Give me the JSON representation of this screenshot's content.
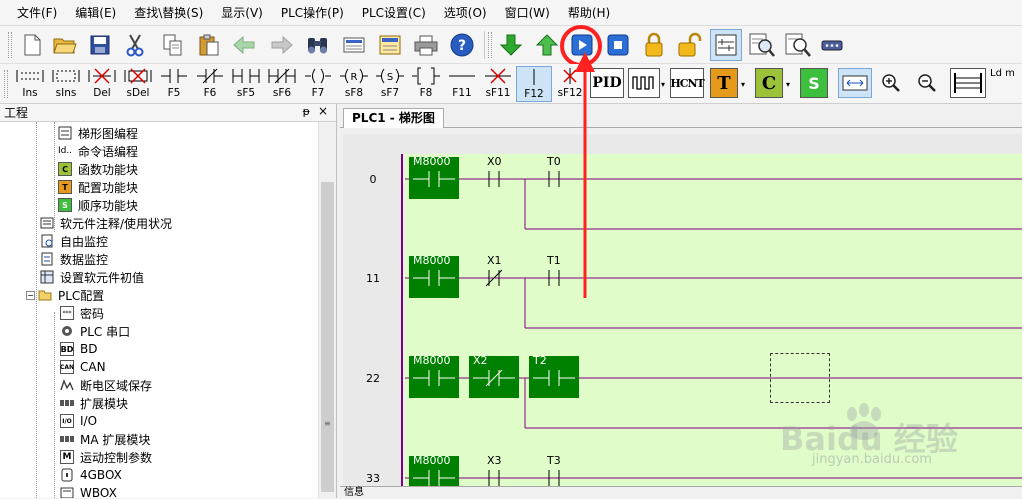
{
  "menu": [
    "文件(F)",
    "编辑(E)",
    "查找\\替换(S)",
    "显示(V)",
    "PLC操作(P)",
    "PLC设置(C)",
    "选项(O)",
    "窗口(W)",
    "帮助(H)"
  ],
  "toolbar1": {
    "icons": [
      "new-file-icon",
      "open-folder-icon",
      "save-icon",
      "cut-icon",
      "copy-icon",
      "paste-icon",
      "back-arrow-icon",
      "forward-arrow-icon",
      "binoculars-icon",
      "keyboard-icon",
      "panel-icon",
      "print-icon",
      "help-icon",
      "download-icon",
      "upload-icon",
      "run-icon",
      "stop-icon",
      "lock-icon",
      "unlock-icon",
      "ladder-monitor-icon",
      "zoom-doc-icon",
      "search-doc-icon",
      "port-icon"
    ],
    "highlighted_button": "run-icon"
  },
  "toolbar2": {
    "ladder_tools": [
      {
        "key": "Ins",
        "label": "Ins"
      },
      {
        "key": "sIns",
        "label": "sIns"
      },
      {
        "key": "Del",
        "label": "Del"
      },
      {
        "key": "sDel",
        "label": "sDel"
      },
      {
        "key": "F5",
        "label": "F5"
      },
      {
        "key": "F6",
        "label": "F6"
      },
      {
        "key": "sF5",
        "label": "sF5"
      },
      {
        "key": "sF6",
        "label": "sF6"
      },
      {
        "key": "F7",
        "label": "F7"
      },
      {
        "key": "sF8",
        "label": "sF8"
      },
      {
        "key": "sF7",
        "label": "sF7"
      },
      {
        "key": "F8",
        "label": "F8"
      },
      {
        "key": "F11",
        "label": "F11"
      },
      {
        "key": "sF11",
        "label": "sF11"
      },
      {
        "key": "F12",
        "label": "F12"
      },
      {
        "key": "sF12",
        "label": "sF12"
      }
    ],
    "instr_buttons": {
      "pid": "PID",
      "hcnt": "HCNT",
      "t": "T",
      "c": "C",
      "s": "S",
      "ld": "Ld m"
    }
  },
  "project_panel": {
    "title": "工程",
    "pin": "ᵽ",
    "close": "×",
    "items": [
      {
        "label": "梯形图编程",
        "icon": "ladder-icon"
      },
      {
        "label": "命令语编程",
        "icon": "instruction-list-icon"
      },
      {
        "label": "函数功能块",
        "icon": "function-block-icon",
        "badge": "C"
      },
      {
        "label": "配置功能块",
        "icon": "config-block-icon",
        "badge": "T"
      },
      {
        "label": "顺序功能块",
        "icon": "sequence-block-icon",
        "badge": "S"
      },
      {
        "label": "软元件注释/使用状况",
        "icon": "comment-icon"
      },
      {
        "label": "自由监控",
        "icon": "free-monitor-icon"
      },
      {
        "label": "数据监控",
        "icon": "data-monitor-icon"
      },
      {
        "label": "设置软元件初值",
        "icon": "init-value-icon"
      },
      {
        "label": "PLC配置",
        "icon": "folder-icon"
      },
      {
        "label": "密码",
        "icon": "password-icon"
      },
      {
        "label": "PLC 串口",
        "icon": "serial-port-icon"
      },
      {
        "label": "BD",
        "icon": "bd-icon",
        "badge": "BD"
      },
      {
        "label": "CAN",
        "icon": "can-icon",
        "badge": "CAN"
      },
      {
        "label": "断电区域保存",
        "icon": "power-save-icon"
      },
      {
        "label": "扩展模块",
        "icon": "expansion-module-icon"
      },
      {
        "label": "I/O",
        "icon": "io-icon",
        "badge": "I/O"
      },
      {
        "label": "MA 扩展模块",
        "icon": "ma-module-icon"
      },
      {
        "label": "运动控制参数",
        "icon": "motion-param-icon",
        "badge": "M"
      },
      {
        "label": "4GBOX",
        "icon": "4gbox-icon"
      },
      {
        "label": "WBOX",
        "icon": "wbox-icon"
      }
    ]
  },
  "editor": {
    "tab_label": "PLC1 - 梯形图",
    "rungs": [
      {
        "step": "0",
        "contacts": [
          {
            "name": "M8000",
            "type": "no",
            "filled": true
          },
          {
            "name": "X0",
            "type": "no",
            "filled": false
          },
          {
            "name": "T0",
            "type": "no",
            "filled": false
          }
        ]
      },
      {
        "step": "11",
        "contacts": [
          {
            "name": "M8000",
            "type": "no",
            "filled": true
          },
          {
            "name": "X1",
            "type": "nc",
            "filled": false
          },
          {
            "name": "T1",
            "type": "no",
            "filled": false
          }
        ]
      },
      {
        "step": "22",
        "contacts": [
          {
            "name": "M8000",
            "type": "no",
            "filled": true
          },
          {
            "name": "X2",
            "type": "nc",
            "filled": true
          },
          {
            "name": "T2",
            "type": "no",
            "filled": true
          }
        ]
      },
      {
        "step": "33",
        "contacts": [
          {
            "name": "M8000",
            "type": "no",
            "filled": true
          },
          {
            "name": "X3",
            "type": "no",
            "filled": false
          },
          {
            "name": "T3",
            "type": "no",
            "filled": false
          }
        ]
      }
    ]
  },
  "info_label": "信息",
  "watermark": {
    "brand": "Baidu 经验",
    "url": "jingyan.baidu.com"
  },
  "colors": {
    "rung_bg": "#e0fcc8",
    "contact_fill": "#008000",
    "power_rail": "#800080",
    "highlight": "#ff2020",
    "selected_tool": "#cde4f7"
  }
}
